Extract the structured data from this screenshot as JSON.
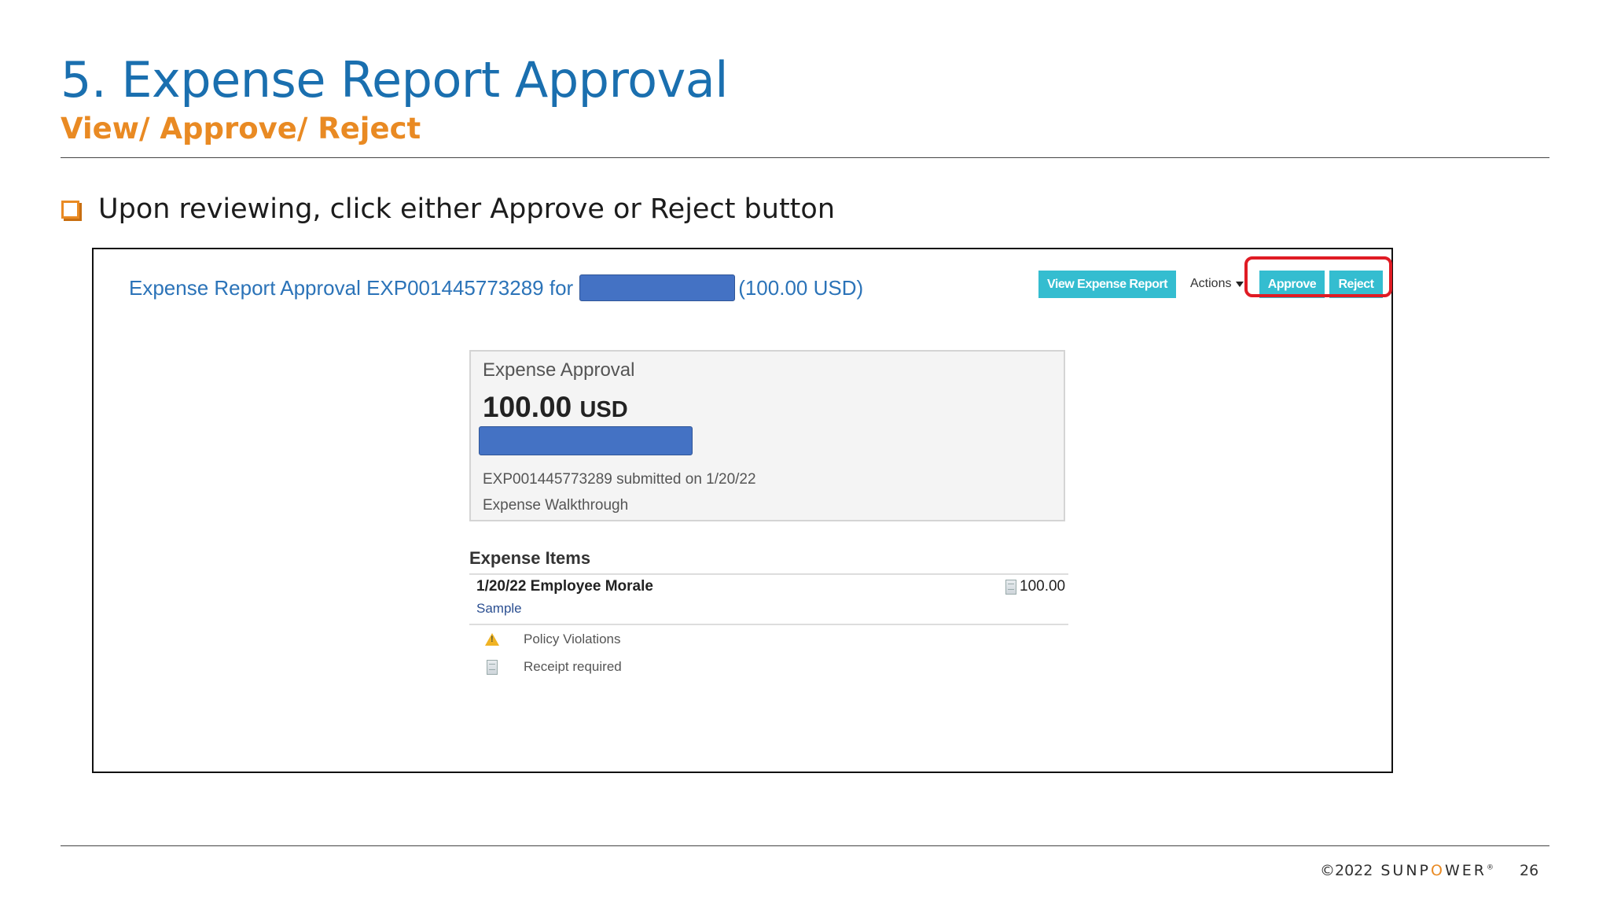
{
  "slide": {
    "title": "5. Expense Report Approval",
    "subtitle": "View/ Approve/ Reject",
    "bullet": "Upon reviewing, click either Approve or Reject button",
    "copyright": "©2022",
    "brand_pre": "SUNP",
    "brand_o": "O",
    "brand_post": "WER",
    "brand_mark": "®",
    "page_number": "26"
  },
  "report": {
    "header_prefix": "Expense Report Approval EXP001445773289 for",
    "header_amount": "(100.00 USD)",
    "view_button": "View Expense Report",
    "actions_label": "Actions",
    "approve_button": "Approve",
    "reject_button": "Reject"
  },
  "card": {
    "title": "Expense Approval",
    "amount": "100.00",
    "currency": "USD",
    "submitted": "EXP001445773289 submitted on 1/20/22",
    "description": "Expense Walkthrough"
  },
  "items": {
    "heading": "Expense Items",
    "rows": [
      {
        "title": "1/20/22 Employee Morale",
        "sub": "Sample",
        "amount": "100.00"
      }
    ],
    "flags": [
      "Policy Violations",
      "Receipt required"
    ]
  },
  "colors": {
    "title_blue": "#1a6faf",
    "accent_orange": "#e98a23",
    "button_teal": "#34bdd0",
    "highlight_red": "#e01b24",
    "redaction_blue": "#4472c4"
  }
}
